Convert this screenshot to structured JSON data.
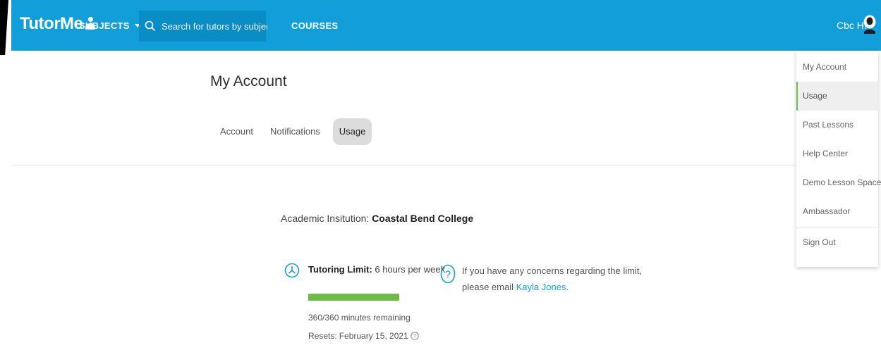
{
  "header": {
    "logo_text": "TutorMe",
    "subjects_label": "SUBJECTS",
    "search_placeholder": "Search for tutors by subject",
    "courses_label": "COURSES",
    "user_name": "Cbc H.",
    "brand_color": "#129fd9"
  },
  "page": {
    "title": "My Account",
    "tabs": [
      {
        "label": "Account",
        "active": false
      },
      {
        "label": "Notifications",
        "active": false
      },
      {
        "label": "Usage",
        "active": true
      }
    ]
  },
  "usage": {
    "institution_label": "Academic Insitution:",
    "institution_name": "Coastal Bend College",
    "limit_label": "Tutoring Limit:",
    "limit_value": "6 hours per week",
    "progress_fraction": 1.0,
    "progress_color": "#6cbd45",
    "remaining_text": "360/360 minutes remaining",
    "resets_label": "Resets:",
    "resets_date": "February 15, 2021",
    "concerns_line1": "If you have any concerns regarding the limit,",
    "concerns_line2_prefix": "please email",
    "contact_name": "Kayla Jones",
    "concerns_line2_suffix": "."
  },
  "dropdown": {
    "items": [
      {
        "label": "My Account",
        "active": false
      },
      {
        "label": "Usage",
        "active": true
      },
      {
        "label": "Past Lessons",
        "active": false
      },
      {
        "label": "Help Center",
        "active": false
      },
      {
        "label": "Demo Lesson Space",
        "active": false
      },
      {
        "label": "Ambassador",
        "active": false
      }
    ],
    "sign_out_label": "Sign Out"
  },
  "icons": {
    "search": "search-icon",
    "user": "user-avatar-icon",
    "clock": "clock-icon",
    "question": "question-circle-icon",
    "info": "question-circle-small-icon"
  }
}
